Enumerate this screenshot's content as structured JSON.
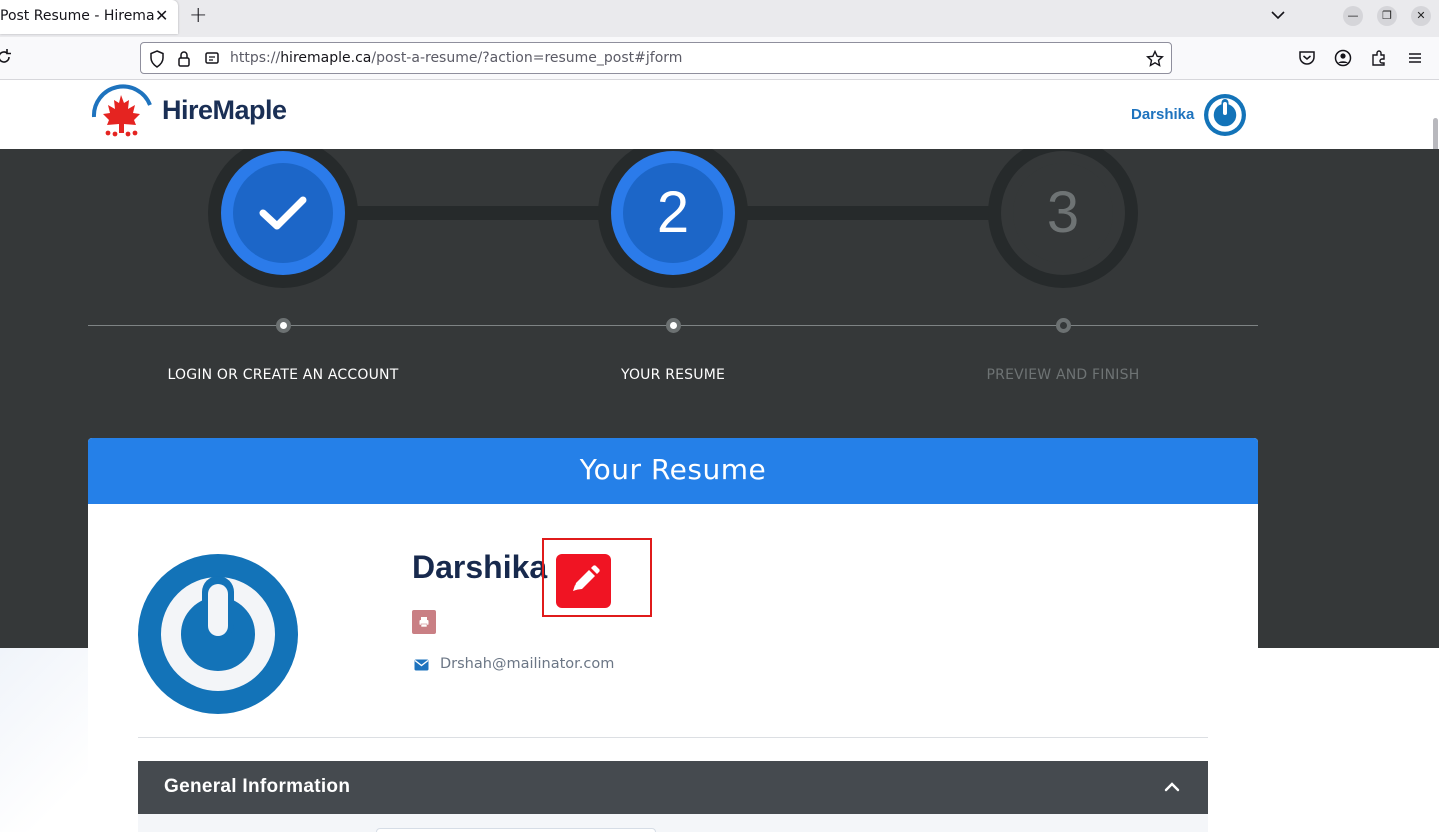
{
  "browser": {
    "tab_title": "Post Resume - Hiremaple",
    "url_host": "hiremaple.ca",
    "url_prefix": "https://",
    "url_path": "/post-a-resume/?action=resume_post#jform"
  },
  "header": {
    "brand": "HireMaple",
    "user_name": "Darshika"
  },
  "steps": [
    {
      "number": "✓",
      "label": "LOGIN OR CREATE AN ACCOUNT",
      "state": "done"
    },
    {
      "number": "2",
      "label": "YOUR RESUME",
      "state": "active"
    },
    {
      "number": "3",
      "label": "PREVIEW AND FINISH",
      "state": "pending"
    }
  ],
  "card": {
    "title": "Your Resume",
    "candidate_name": "Darshika",
    "email": "Drshah@mailinator.com",
    "section_title": "General Information"
  },
  "colors": {
    "accent_blue": "#2580e8",
    "step_blue": "#1c66c8",
    "hero_dark": "#353839",
    "edit_red": "#f01423",
    "highlight_red": "#e01b1b"
  }
}
